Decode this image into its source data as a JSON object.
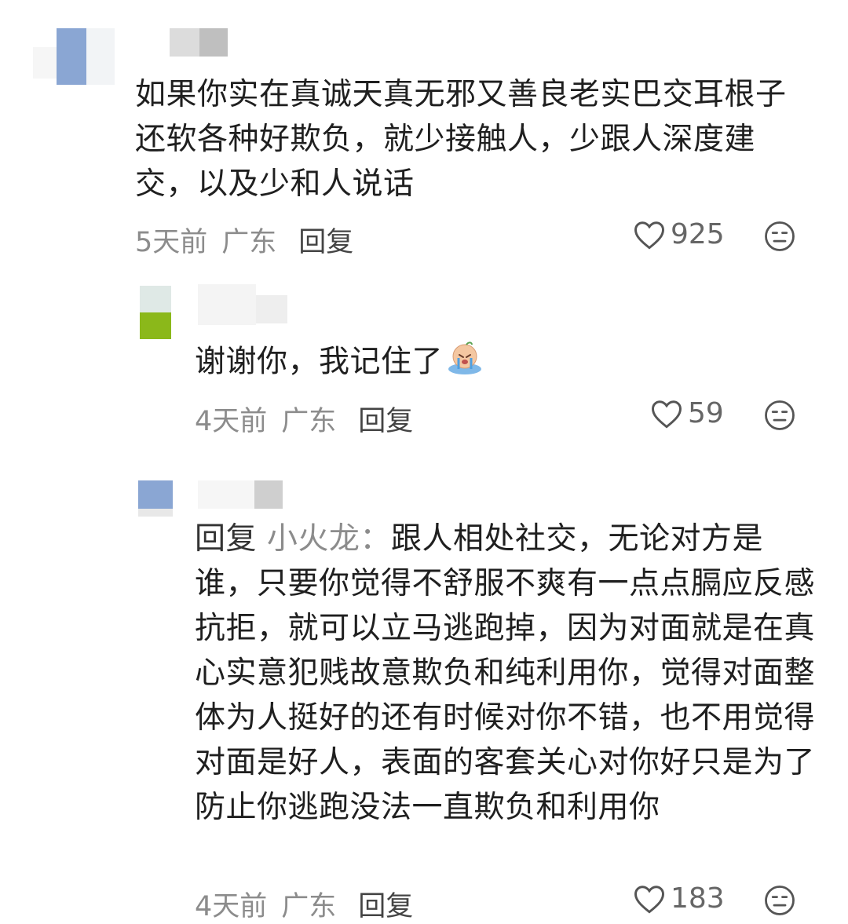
{
  "comments": [
    {
      "text": "如果你实在真诚天真无邪又善良老实巴交耳根子还软各种好欺负，就少接触人，少跟人深度建交，以及少和人说话",
      "time": "5天前",
      "region": "广东",
      "reply_label": "回复",
      "likes": "925"
    },
    {
      "text": "谢谢你，我记住了",
      "time": "4天前",
      "region": "广东",
      "reply_label": "回复",
      "likes": "59"
    },
    {
      "reply_prefix": "回复",
      "reply_target": "小火龙：",
      "text": "跟人相处社交，无论对方是谁，只要你觉得不舒服不爽有一点点膈应反感抗拒，就可以立马逃跑掉，因为对面就是在真心实意犯贱故意欺负和纯利用你，觉得对面整体为人挺好的还有时候对你不错，也不用觉得对面是好人，表面的客套关心对你好只是为了防止你逃跑没法一直欺负和利用你",
      "time": "4天前",
      "region": "广东",
      "reply_label": "回复",
      "likes": "183"
    }
  ],
  "icons": {
    "like": "heart-outline-icon",
    "dislike": "neutral-face-icon",
    "emoji": "crying-emoji-icon"
  }
}
